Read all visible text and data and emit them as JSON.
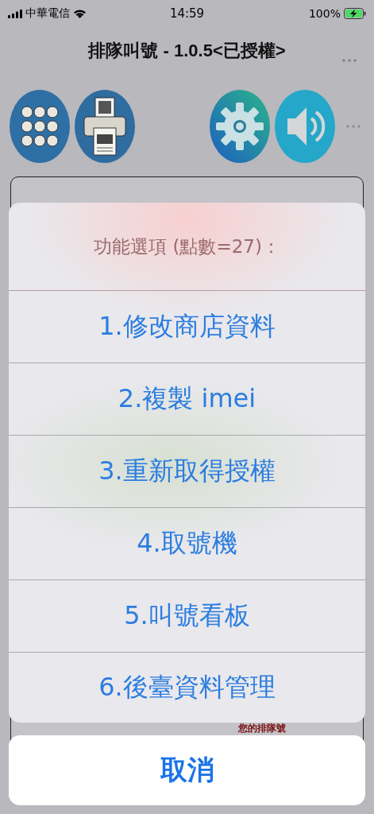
{
  "status_bar": {
    "carrier": "中華電信",
    "time": "14:59",
    "battery": "100%"
  },
  "title": "排隊叫號 - 1.0.5<已授權>",
  "toolbar": [
    {
      "kind": "keypad"
    },
    {
      "kind": "ticket"
    },
    {
      "kind": "gap"
    },
    {
      "kind": "settings"
    },
    {
      "kind": "sound"
    }
  ],
  "background_label": "您的排隊號",
  "action_sheet": {
    "title": "功能選項 (點數=27)：",
    "options": [
      "1.修改商店資料",
      "2.複製 imei",
      "3.重新取得授權",
      "4.取號機",
      "5.叫號看板",
      "6.後臺資料管理"
    ],
    "cancel": "取消"
  }
}
